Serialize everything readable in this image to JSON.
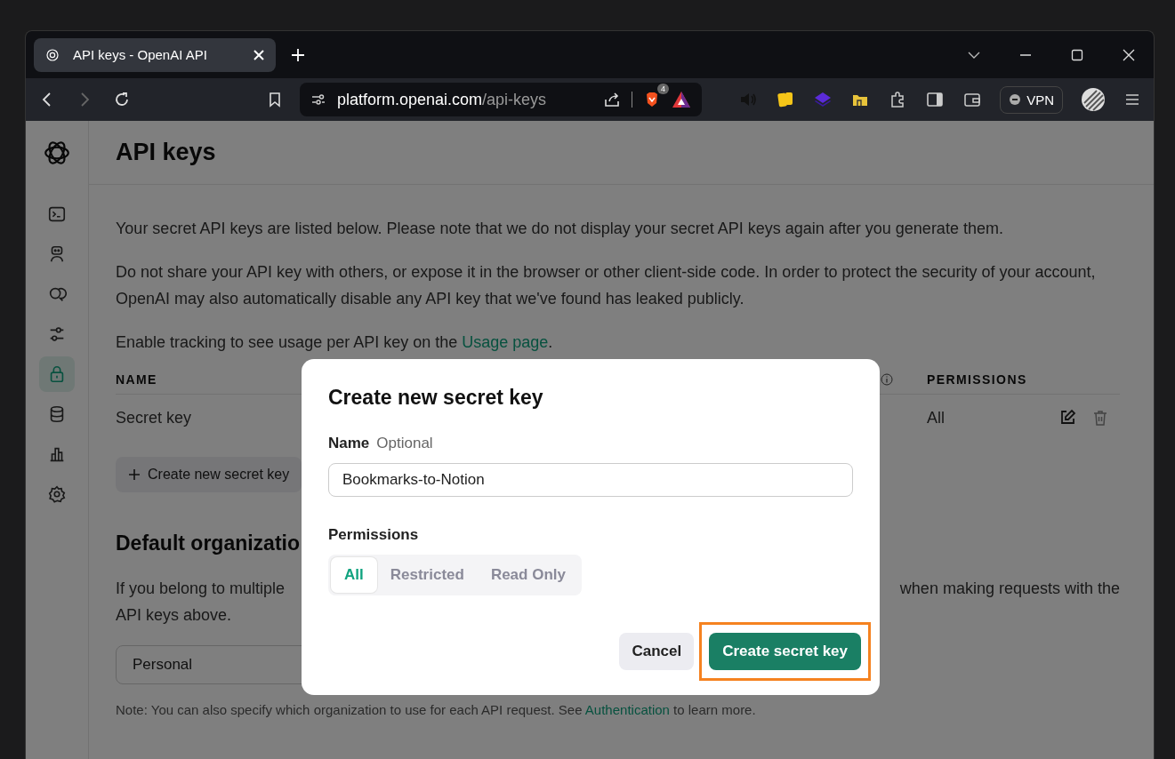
{
  "browser": {
    "tab": {
      "title": "API keys - OpenAI API"
    },
    "url": {
      "host": "platform.openai.com",
      "path": "/api-keys"
    },
    "shields_count": "4",
    "vpn_label": "VPN"
  },
  "sidebar": {
    "items": [
      {
        "kind": "terminal",
        "selected": false
      },
      {
        "kind": "assistant",
        "selected": false
      },
      {
        "kind": "chat",
        "selected": false
      },
      {
        "kind": "tune",
        "selected": false
      },
      {
        "kind": "lock",
        "selected": true
      },
      {
        "kind": "storage",
        "selected": false
      },
      {
        "kind": "chart",
        "selected": false
      },
      {
        "kind": "settings",
        "selected": false
      }
    ]
  },
  "page": {
    "title": "API keys",
    "paragraphs": [
      "Your secret API keys are listed below. Please note that we do not display your secret API keys again after you generate them.",
      "Do not share your API key with others, or expose it in the browser or other client-side code. In order to protect the security of your account, OpenAI may also automatically disable any API key that we've found has leaked publicly."
    ],
    "tracking": {
      "before": "Enable tracking to see usage per API key on the ",
      "link": "Usage page",
      "after": "."
    },
    "table": {
      "columns": [
        "NAME",
        "PERMISSIONS"
      ],
      "rows": [
        {
          "name": "Secret key",
          "permissions": "All"
        }
      ]
    },
    "create_button": "Create new secret key",
    "org_heading": "Default organizatio",
    "org_text_fragments": [
      "If you belong to multiple",
      "when making requests with the"
    ],
    "org_text_end": "API keys above.",
    "org_select": "Personal",
    "note": {
      "before": "Note: You can also specify which organization to use for each API request. See ",
      "link": "Authentication",
      "after": " to learn more."
    }
  },
  "dialog": {
    "title": "Create new secret key",
    "name_label": "Name",
    "name_hint": "Optional",
    "name_value": "Bookmarks-to-Notion",
    "permissions_label": "Permissions",
    "permissions": [
      {
        "label": "All",
        "selected": true
      },
      {
        "label": "Restricted",
        "selected": false
      },
      {
        "label": "Read Only",
        "selected": false
      }
    ],
    "cancel": "Cancel",
    "submit": {
      "label": "Create secret key",
      "highlighted": true
    }
  }
}
